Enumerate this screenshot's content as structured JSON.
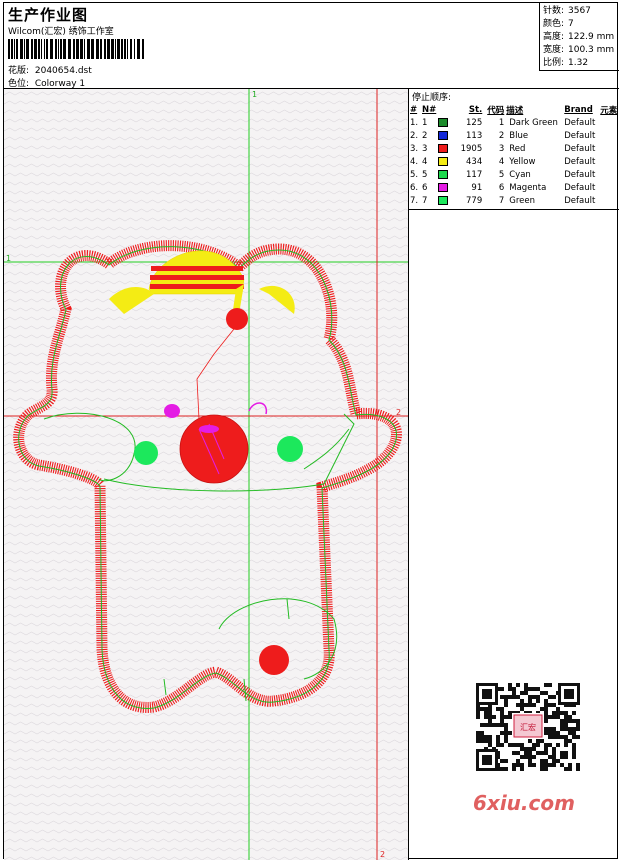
{
  "header": {
    "title": "生产作业图",
    "studio": "Wilcom(汇宏) 绣饰工作室",
    "design_label": "花版:",
    "design_value": "2040654.dst",
    "colorway_label": "色位:",
    "colorway_value": "Colorway 1"
  },
  "stats": [
    {
      "label": "针数:",
      "value": "3567"
    },
    {
      "label": "颜色:",
      "value": "7"
    },
    {
      "label": "高度:",
      "value": "122.9 mm"
    },
    {
      "label": "宽度:",
      "value": "100.3 mm"
    },
    {
      "label": "比例:",
      "value": "1.32"
    }
  ],
  "axis_labels": {
    "v1": "1",
    "h1": "1",
    "h2": "2",
    "v2": "2"
  },
  "stop_sequence": {
    "caption": "停止顺序:",
    "columns": [
      "#",
      "N#",
      "St.",
      "代码",
      "描述",
      "Brand",
      "元素"
    ],
    "rows": [
      {
        "idx": "1.",
        "n": "1",
        "color": "#1c8c2c",
        "st": "125",
        "code": "1",
        "desc": "Dark Green",
        "brand": "Default"
      },
      {
        "idx": "2.",
        "n": "2",
        "color": "#1428d8",
        "st": "113",
        "code": "2",
        "desc": "Blue",
        "brand": "Default"
      },
      {
        "idx": "3.",
        "n": "3",
        "color": "#ee1c1c",
        "st": "1905",
        "code": "3",
        "desc": "Red",
        "brand": "Default"
      },
      {
        "idx": "4.",
        "n": "4",
        "color": "#f4ec14",
        "st": "434",
        "code": "4",
        "desc": "Yellow",
        "brand": "Default"
      },
      {
        "idx": "5.",
        "n": "5",
        "color": "#1cd84c",
        "st": "117",
        "code": "5",
        "desc": "Cyan",
        "brand": "Default"
      },
      {
        "idx": "6.",
        "n": "6",
        "color": "#e41ce4",
        "st": "91",
        "code": "6",
        "desc": "Magenta",
        "brand": "Default"
      },
      {
        "idx": "7.",
        "n": "7",
        "color": "#1ce85c",
        "st": "779",
        "code": "7",
        "desc": "Green",
        "brand": "Default"
      }
    ]
  },
  "watermark": "6xiu.com",
  "qr_center_text": "汇宏"
}
